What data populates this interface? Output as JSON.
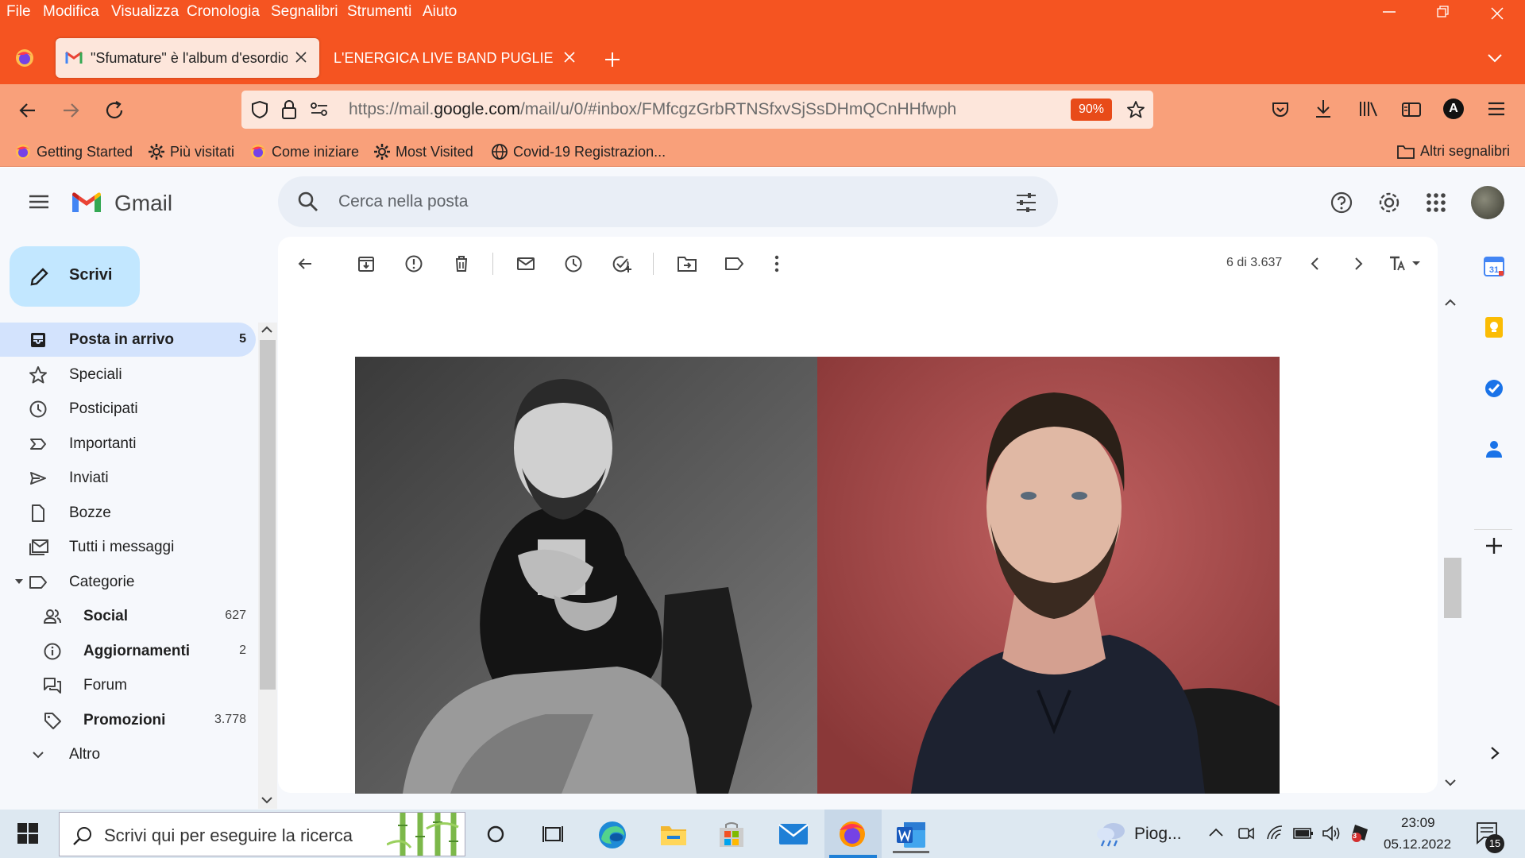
{
  "browser": {
    "menu": [
      "File",
      "Modifica",
      "Visualizza",
      "Cronologia",
      "Segnalibri",
      "Strumenti",
      "Aiuto"
    ],
    "tabs": [
      {
        "title": "\"Sfumature\" è l'album d'esordio",
        "active": true
      },
      {
        "title": "L'ENERGICA LIVE BAND PUGLIESE FL",
        "active": false
      }
    ],
    "url_prefix": "https://mail.",
    "url_domain": "google.com",
    "url_suffix": "/mail/u/0/#inbox/FMfcgzGrbRTNSfxvSjSsDHmQCnHHfwph",
    "zoom": "90%",
    "account_initial": "A",
    "bookmarks": [
      "Getting Started",
      "Più visitati",
      "Come iniziare",
      "Most Visited",
      "Covid-19 Registrazion..."
    ],
    "other_bookmarks": "Altri segnalibri"
  },
  "gmail": {
    "logo_text": "Gmail",
    "search_placeholder": "Cerca nella posta",
    "compose": "Scrivi",
    "nav": [
      {
        "label": "Posta in arrivo",
        "count": "5"
      },
      {
        "label": "Speciali",
        "count": ""
      },
      {
        "label": "Posticipati",
        "count": ""
      },
      {
        "label": "Importanti",
        "count": ""
      },
      {
        "label": "Inviati",
        "count": ""
      },
      {
        "label": "Bozze",
        "count": ""
      },
      {
        "label": "Tutti i messaggi",
        "count": ""
      },
      {
        "label": "Categorie",
        "count": ""
      },
      {
        "label": "Social",
        "count": "627"
      },
      {
        "label": "Aggiornamenti",
        "count": "2"
      },
      {
        "label": "Forum",
        "count": ""
      },
      {
        "label": "Promozioni",
        "count": "3.778"
      },
      {
        "label": "Altro",
        "count": ""
      }
    ],
    "pagination": "6 di 3.637",
    "calendar_day": "31"
  },
  "taskbar": {
    "search_placeholder": "Scrivi qui per eseguire la ricerca",
    "weather": "Piog...",
    "time": "23:09",
    "date": "05.12.2022",
    "notifications": "15",
    "mail_badge": "3"
  },
  "colors": {
    "firefox_orange": "#f55421",
    "navbar": "#f9a07a",
    "gmail_bg": "#f6f8fc",
    "compose": "#c2e7ff",
    "active_nav": "#d3e3fd"
  }
}
